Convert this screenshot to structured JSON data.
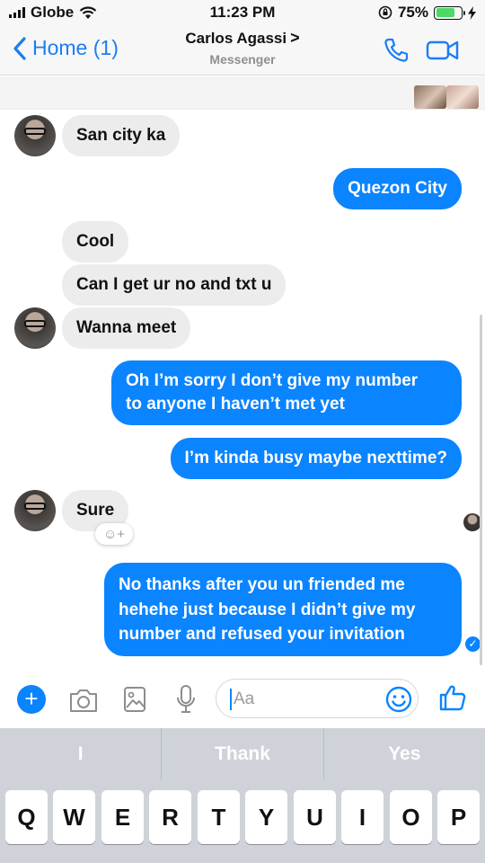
{
  "status_bar": {
    "carrier": "Globe",
    "time": "11:23 PM",
    "battery": "75%",
    "battery_level": 0.75,
    "icons": [
      "signal-icon",
      "wifi-icon",
      "lock-rotation-icon",
      "battery-icon",
      "charging-icon"
    ]
  },
  "header": {
    "back_label": "Home (1)",
    "contact_name": "Carlos Agassi",
    "chevron": ">",
    "app_name": "Messenger",
    "icons": [
      "back-chevron-icon",
      "phone-icon",
      "video-camera-icon"
    ]
  },
  "messages": [
    {
      "side": "received",
      "text": "San city ka",
      "avatar": true
    },
    {
      "side": "sent",
      "text": "Quezon City"
    },
    {
      "side": "received",
      "text": "Cool"
    },
    {
      "side": "received",
      "text": "Can I get ur no and txt u"
    },
    {
      "side": "received",
      "text": "Wanna meet",
      "avatar": true
    },
    {
      "side": "sent",
      "lines": [
        "Oh I’m sorry I don’t give my number",
        "to anyone I haven’t met yet"
      ]
    },
    {
      "side": "sent",
      "text": "I’m kinda busy maybe nexttime?"
    },
    {
      "side": "received",
      "text": "Sure",
      "avatar": true
    },
    {
      "side": "sent",
      "lines": [
        "No thanks after you un friended me",
        "hehehe just because I didn’t give my",
        "number and refused your invitation"
      ]
    }
  ],
  "reaction": {
    "icon": "add-reaction-icon",
    "glyph": "☺+"
  },
  "composer": {
    "placeholder": "Aa",
    "plus_glyph": "+",
    "icons": [
      "plus-icon",
      "camera-icon",
      "image-icon",
      "microphone-icon",
      "emoji-icon",
      "thumbs-up-icon"
    ]
  },
  "keyboard": {
    "suggestions": [
      "I",
      "Thank",
      "Yes"
    ],
    "row1": [
      "Q",
      "W",
      "E",
      "R",
      "T",
      "Y",
      "U",
      "I",
      "O",
      "P"
    ]
  },
  "colors": {
    "accent": "#0a84ff",
    "received_bubble": "#ececec",
    "keyboard_bg": "#cfd3d9"
  }
}
